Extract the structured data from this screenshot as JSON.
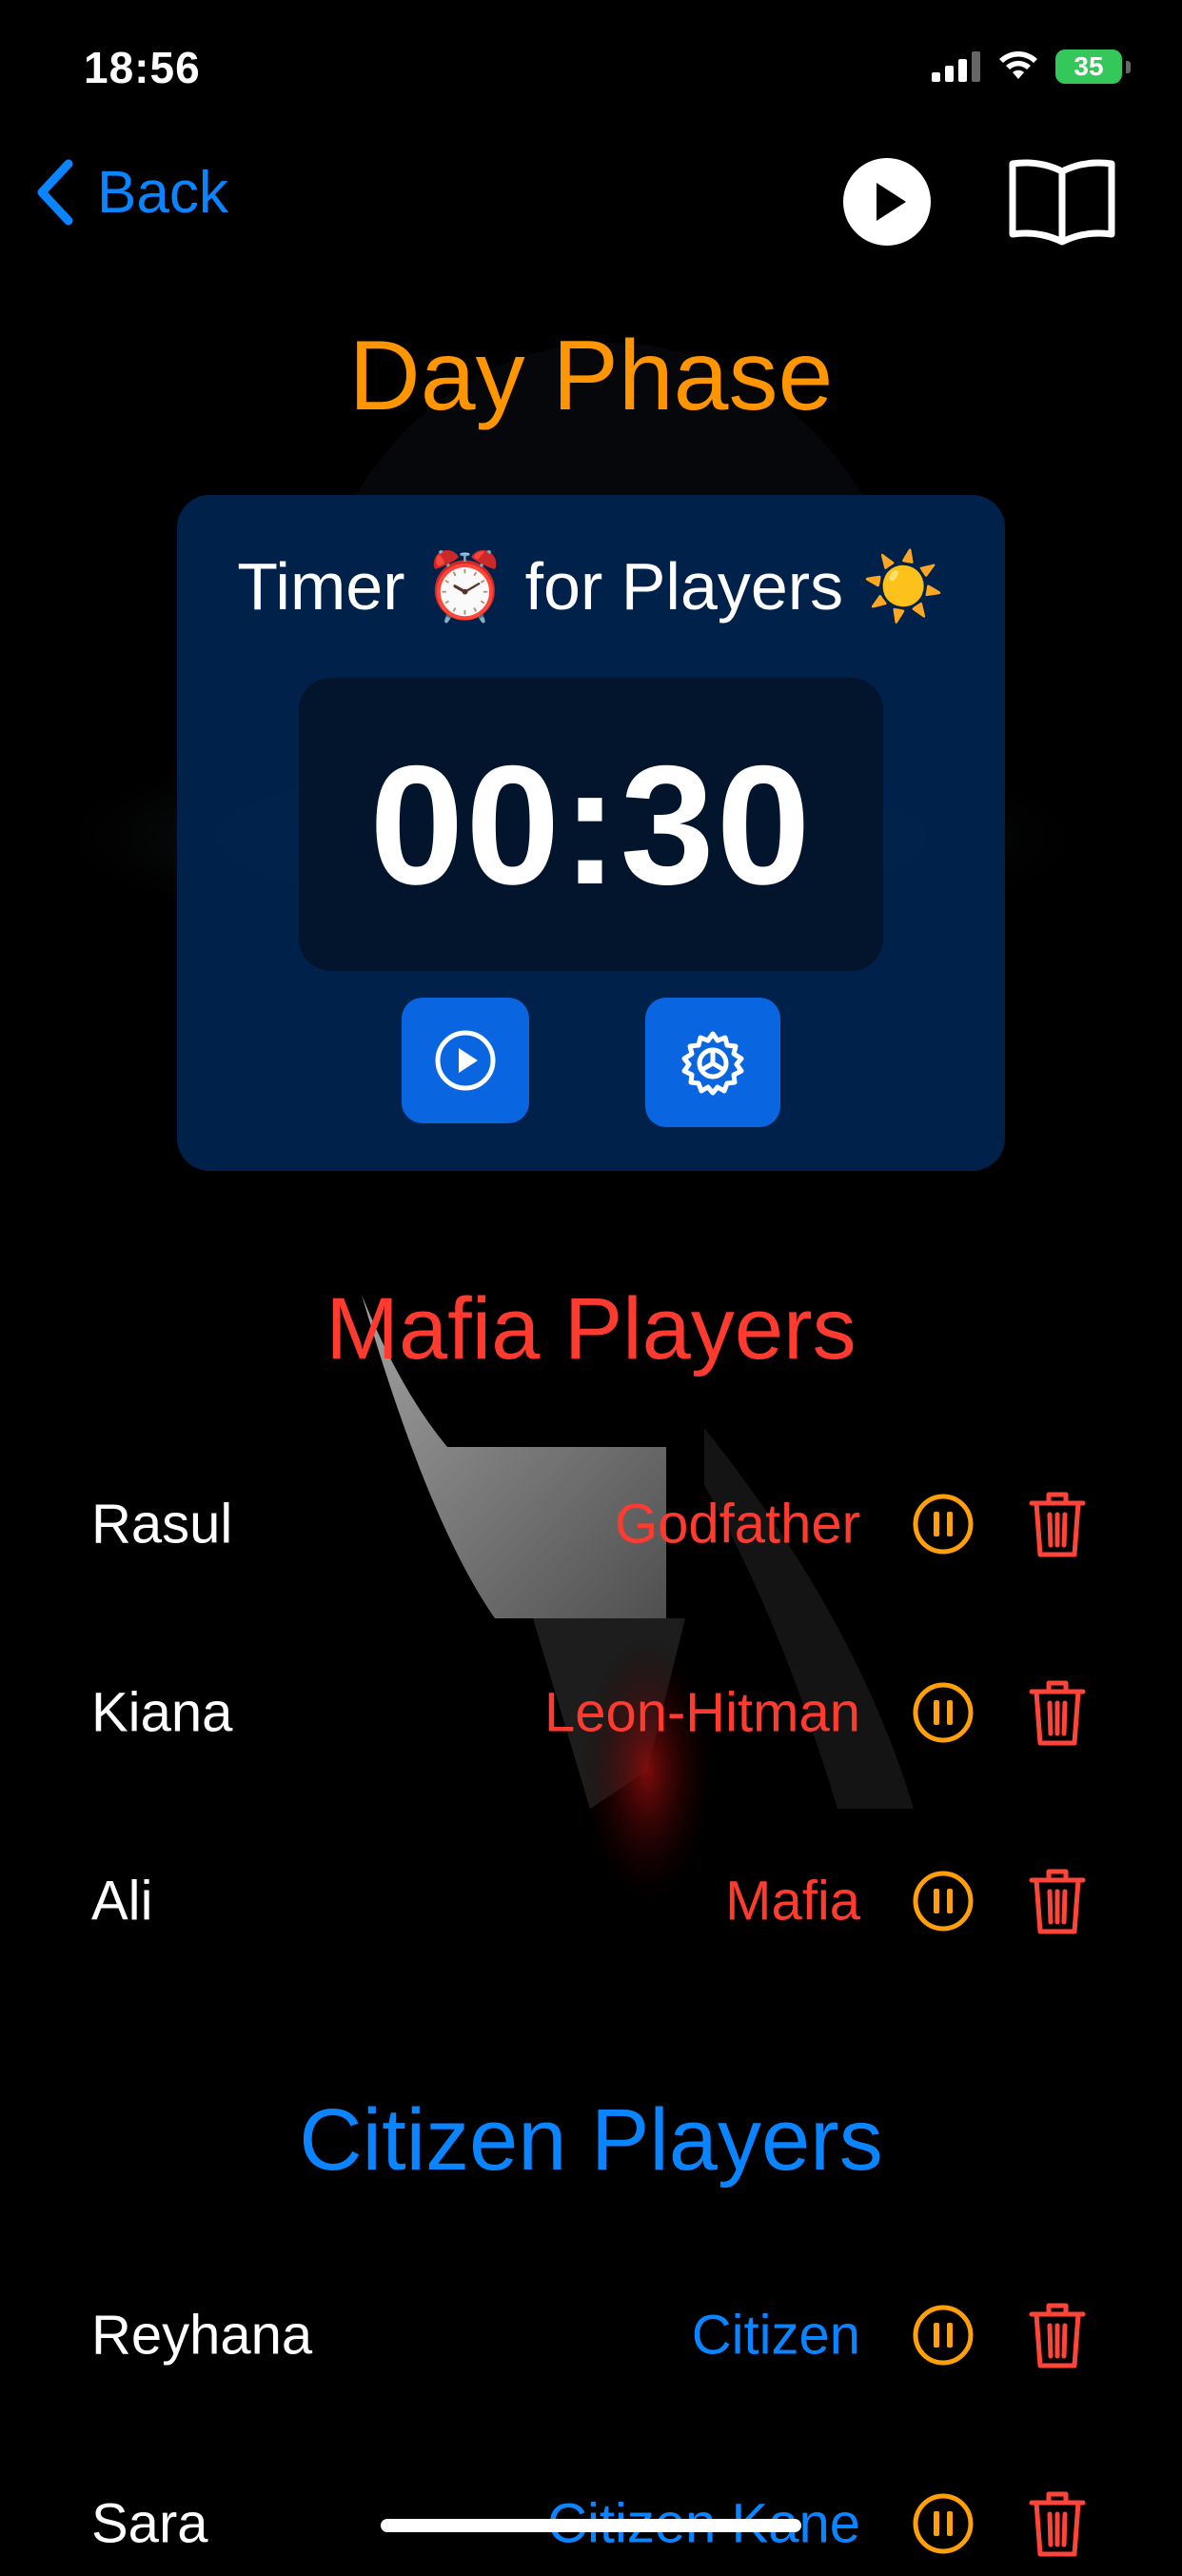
{
  "status_bar": {
    "time": "18:56",
    "battery": "35"
  },
  "nav": {
    "back_label": "Back",
    "play_icon": "play-icon",
    "book_icon": "book-icon"
  },
  "phase_title": "Day Phase",
  "timer": {
    "heading": "Timer ⏰ for Players ☀️",
    "display": "00:30",
    "start_icon": "play-circle-icon",
    "settings_icon": "gear-icon"
  },
  "mafia_section": {
    "title": "Mafia Players",
    "players": [
      {
        "name": "Rasul",
        "role": "Godfather"
      },
      {
        "name": "Kiana",
        "role": "Leon-Hitman"
      },
      {
        "name": "Ali",
        "role": "Mafia"
      }
    ]
  },
  "citizen_section": {
    "title": "Citizen Players",
    "players": [
      {
        "name": "Reyhana",
        "role": "Citizen"
      },
      {
        "name": "Sara",
        "role": "Citizen Kane"
      }
    ]
  },
  "colors": {
    "accent_blue": "#0a84ff",
    "phase_orange": "#ff9500",
    "mafia_red": "#ff3b30",
    "pause_orange": "#ff9f0a",
    "delete_red": "#ff453a",
    "battery_green": "#34c759"
  }
}
